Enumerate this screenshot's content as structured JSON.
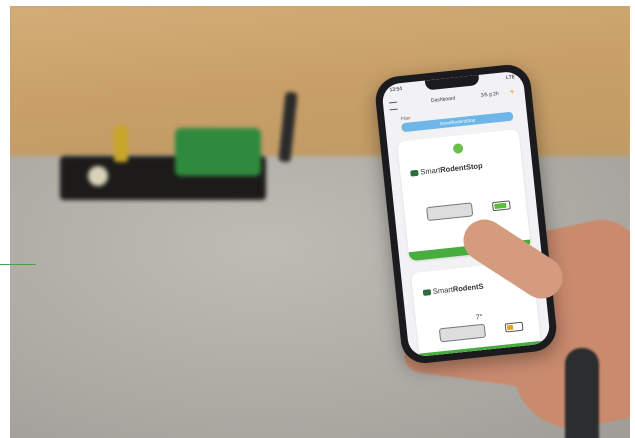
{
  "phone": {
    "status_time": "13:54",
    "status_signal": "LTE",
    "title": "Dashboard",
    "top_right": "3/5 g   2h",
    "filter_label": "Filter",
    "button_label": "SmartRodentStop",
    "cards": [
      {
        "brand_light": "Smart",
        "brand_bold": "RodentStop",
        "battery_level": 1.0,
        "status": "green"
      },
      {
        "brand_light": "Smart",
        "brand_bold": "RodentS",
        "temperature": "7°",
        "battery_level": 0.4,
        "status": "green"
      }
    ]
  },
  "colors": {
    "status_green": "#46ad3e",
    "accent_blue": "#6fb6e8",
    "battery_low": "#e2a32b"
  }
}
